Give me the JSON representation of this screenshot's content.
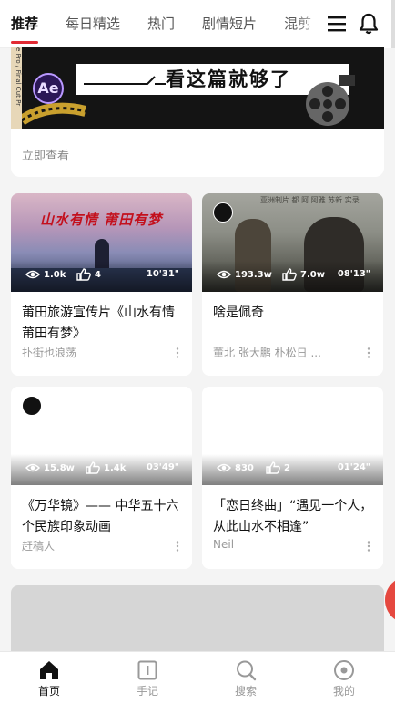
{
  "tabs": [
    "推荐",
    "每日精选",
    "热门",
    "剧情短片",
    "混剪"
  ],
  "banner": {
    "side_text": "e Pro / Final Cut Pr",
    "logo_text": "Ae",
    "headline": "看这篇就够了",
    "link_label": "立即查看"
  },
  "videos": [
    {
      "thumb_text": "山水有情 莆田有梦",
      "views": "1.0k",
      "likes": "4",
      "duration": "10'31\"",
      "title": "莆田旅游宣传片《山水有情 莆田有梦》",
      "author": "扑街也浪荡"
    },
    {
      "thumb_text": "亚洲制片 都 阿 阿雅 苏新 实录",
      "views": "193.3w",
      "likes": "7.0w",
      "duration": "08'13\"",
      "title": "啥是佩奇",
      "author": "董北 张大鹏 朴松日 ..."
    },
    {
      "views": "15.8w",
      "likes": "1.4k",
      "duration": "03'49\"",
      "title": "《万华镜》—— 中华五十六个民族印象动画",
      "author": "赶稿人"
    },
    {
      "views": "830",
      "likes": "2",
      "duration": "01'24\"",
      "title": "「恋日终曲」“遇见一个人，从此山水不相逢”",
      "author": "Neil"
    }
  ],
  "bottom_nav": [
    {
      "label": "首页",
      "icon": "home-icon",
      "active": true
    },
    {
      "label": "手记",
      "icon": "notebook-icon",
      "active": false
    },
    {
      "label": "搜索",
      "icon": "search-icon",
      "active": false
    },
    {
      "label": "我的",
      "icon": "profile-icon",
      "active": false
    }
  ],
  "colors": {
    "accent": "#e22b34",
    "float_button": "#e5483f"
  }
}
